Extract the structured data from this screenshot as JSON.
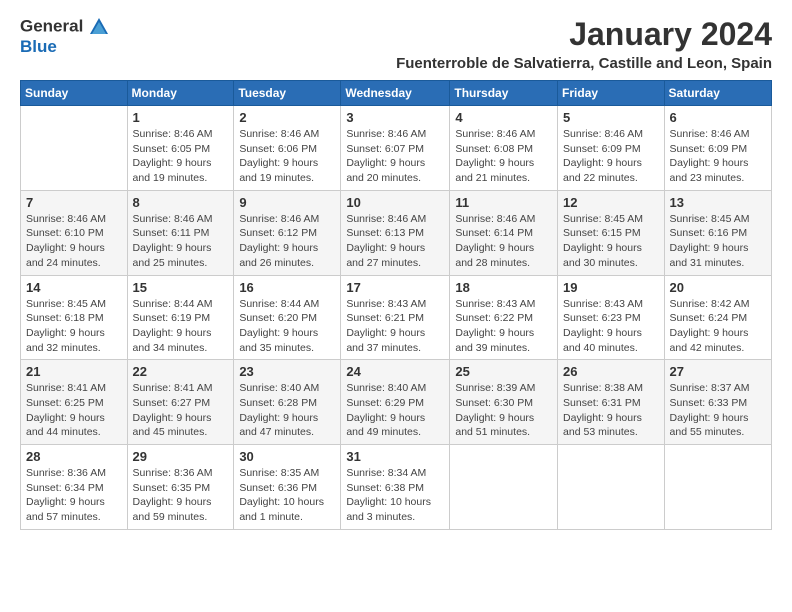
{
  "logo": {
    "text1": "General",
    "text2": "Blue"
  },
  "title": "January 2024",
  "subtitle": "Fuenterroble de Salvatierra, Castille and Leon, Spain",
  "headers": [
    "Sunday",
    "Monday",
    "Tuesday",
    "Wednesday",
    "Thursday",
    "Friday",
    "Saturday"
  ],
  "weeks": [
    [
      {
        "day": "",
        "info": ""
      },
      {
        "day": "1",
        "info": "Sunrise: 8:46 AM\nSunset: 6:05 PM\nDaylight: 9 hours\nand 19 minutes."
      },
      {
        "day": "2",
        "info": "Sunrise: 8:46 AM\nSunset: 6:06 PM\nDaylight: 9 hours\nand 19 minutes."
      },
      {
        "day": "3",
        "info": "Sunrise: 8:46 AM\nSunset: 6:07 PM\nDaylight: 9 hours\nand 20 minutes."
      },
      {
        "day": "4",
        "info": "Sunrise: 8:46 AM\nSunset: 6:08 PM\nDaylight: 9 hours\nand 21 minutes."
      },
      {
        "day": "5",
        "info": "Sunrise: 8:46 AM\nSunset: 6:09 PM\nDaylight: 9 hours\nand 22 minutes."
      },
      {
        "day": "6",
        "info": "Sunrise: 8:46 AM\nSunset: 6:09 PM\nDaylight: 9 hours\nand 23 minutes."
      }
    ],
    [
      {
        "day": "7",
        "info": "Sunrise: 8:46 AM\nSunset: 6:10 PM\nDaylight: 9 hours\nand 24 minutes."
      },
      {
        "day": "8",
        "info": "Sunrise: 8:46 AM\nSunset: 6:11 PM\nDaylight: 9 hours\nand 25 minutes."
      },
      {
        "day": "9",
        "info": "Sunrise: 8:46 AM\nSunset: 6:12 PM\nDaylight: 9 hours\nand 26 minutes."
      },
      {
        "day": "10",
        "info": "Sunrise: 8:46 AM\nSunset: 6:13 PM\nDaylight: 9 hours\nand 27 minutes."
      },
      {
        "day": "11",
        "info": "Sunrise: 8:46 AM\nSunset: 6:14 PM\nDaylight: 9 hours\nand 28 minutes."
      },
      {
        "day": "12",
        "info": "Sunrise: 8:45 AM\nSunset: 6:15 PM\nDaylight: 9 hours\nand 30 minutes."
      },
      {
        "day": "13",
        "info": "Sunrise: 8:45 AM\nSunset: 6:16 PM\nDaylight: 9 hours\nand 31 minutes."
      }
    ],
    [
      {
        "day": "14",
        "info": "Sunrise: 8:45 AM\nSunset: 6:18 PM\nDaylight: 9 hours\nand 32 minutes."
      },
      {
        "day": "15",
        "info": "Sunrise: 8:44 AM\nSunset: 6:19 PM\nDaylight: 9 hours\nand 34 minutes."
      },
      {
        "day": "16",
        "info": "Sunrise: 8:44 AM\nSunset: 6:20 PM\nDaylight: 9 hours\nand 35 minutes."
      },
      {
        "day": "17",
        "info": "Sunrise: 8:43 AM\nSunset: 6:21 PM\nDaylight: 9 hours\nand 37 minutes."
      },
      {
        "day": "18",
        "info": "Sunrise: 8:43 AM\nSunset: 6:22 PM\nDaylight: 9 hours\nand 39 minutes."
      },
      {
        "day": "19",
        "info": "Sunrise: 8:43 AM\nSunset: 6:23 PM\nDaylight: 9 hours\nand 40 minutes."
      },
      {
        "day": "20",
        "info": "Sunrise: 8:42 AM\nSunset: 6:24 PM\nDaylight: 9 hours\nand 42 minutes."
      }
    ],
    [
      {
        "day": "21",
        "info": "Sunrise: 8:41 AM\nSunset: 6:25 PM\nDaylight: 9 hours\nand 44 minutes."
      },
      {
        "day": "22",
        "info": "Sunrise: 8:41 AM\nSunset: 6:27 PM\nDaylight: 9 hours\nand 45 minutes."
      },
      {
        "day": "23",
        "info": "Sunrise: 8:40 AM\nSunset: 6:28 PM\nDaylight: 9 hours\nand 47 minutes."
      },
      {
        "day": "24",
        "info": "Sunrise: 8:40 AM\nSunset: 6:29 PM\nDaylight: 9 hours\nand 49 minutes."
      },
      {
        "day": "25",
        "info": "Sunrise: 8:39 AM\nSunset: 6:30 PM\nDaylight: 9 hours\nand 51 minutes."
      },
      {
        "day": "26",
        "info": "Sunrise: 8:38 AM\nSunset: 6:31 PM\nDaylight: 9 hours\nand 53 minutes."
      },
      {
        "day": "27",
        "info": "Sunrise: 8:37 AM\nSunset: 6:33 PM\nDaylight: 9 hours\nand 55 minutes."
      }
    ],
    [
      {
        "day": "28",
        "info": "Sunrise: 8:36 AM\nSunset: 6:34 PM\nDaylight: 9 hours\nand 57 minutes."
      },
      {
        "day": "29",
        "info": "Sunrise: 8:36 AM\nSunset: 6:35 PM\nDaylight: 9 hours\nand 59 minutes."
      },
      {
        "day": "30",
        "info": "Sunrise: 8:35 AM\nSunset: 6:36 PM\nDaylight: 10 hours\nand 1 minute."
      },
      {
        "day": "31",
        "info": "Sunrise: 8:34 AM\nSunset: 6:38 PM\nDaylight: 10 hours\nand 3 minutes."
      },
      {
        "day": "",
        "info": ""
      },
      {
        "day": "",
        "info": ""
      },
      {
        "day": "",
        "info": ""
      }
    ]
  ]
}
